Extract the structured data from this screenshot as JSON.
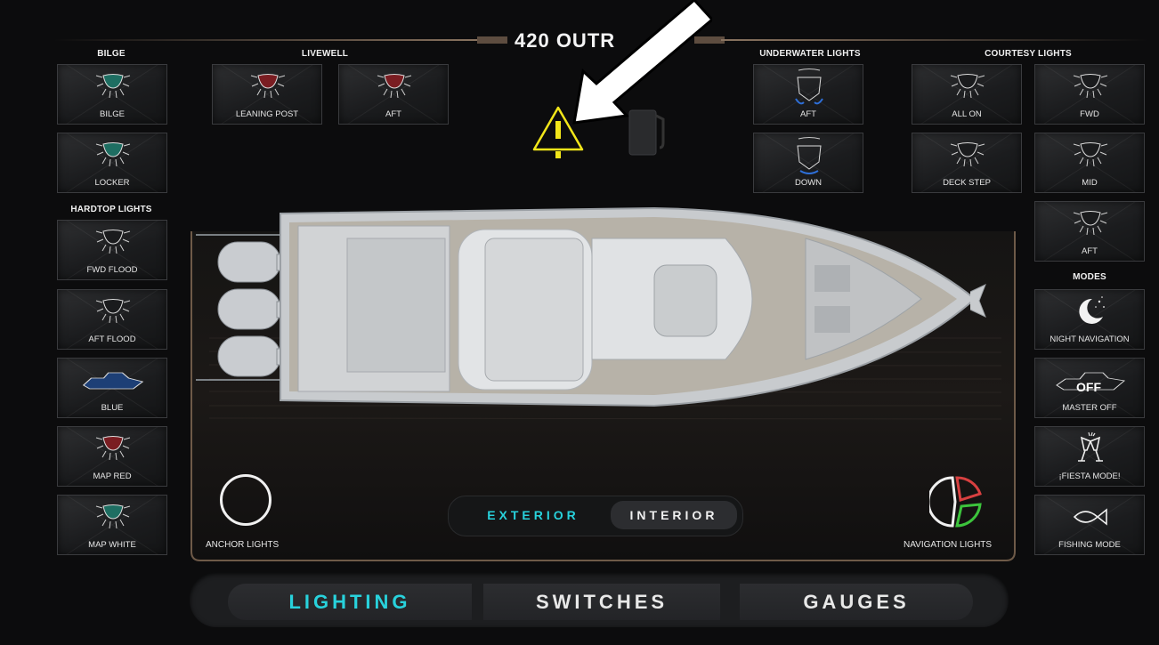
{
  "title": "420 OUTR",
  "sections": {
    "bilge": "BILGE",
    "livewell": "LIVEWELL",
    "underwater": "UNDERWATER LIGHTS",
    "courtesy": "COURTESY LIGHTS",
    "hardtop": "HARDTOP LIGHTS",
    "modes": "MODES"
  },
  "tiles": {
    "bilge": "BILGE",
    "locker": "LOCKER",
    "leaning_post": "LEANING POST",
    "livewell_aft": "AFT",
    "uw_aft": "AFT",
    "uw_down": "DOWN",
    "all_on": "ALL ON",
    "fwd": "FWD",
    "deck_step": "DECK STEP",
    "mid": "MID",
    "courtesy_aft": "AFT",
    "fwd_flood": "FWD FLOOD",
    "aft_flood": "AFT FLOOD",
    "blue": "BLUE",
    "map_red": "MAP RED",
    "map_white": "MAP WHITE",
    "night_navigation": "NIGHT NAVIGATION",
    "master_off": "MASTER OFF",
    "master_off_badge": "OFF",
    "fiesta": "¡FIESTA MODE!",
    "fishing": "FISHING MODE"
  },
  "anchor_lights": "ANCHOR LIGHTS",
  "navigation_lights": "NAVIGATION LIGHTS",
  "toggle": {
    "exterior": "EXTERIOR",
    "interior": "INTERIOR"
  },
  "nav": {
    "lighting": "LIGHTING",
    "switches": "SWITCHES",
    "gauges": "GAUGES"
  },
  "colors": {
    "accent_cyan": "#28d2dc",
    "teal_light": "#1e6e62",
    "red_light": "#7a1d22",
    "warning_yellow": "#f2e61a",
    "frame_bronze": "#6e5a48"
  }
}
